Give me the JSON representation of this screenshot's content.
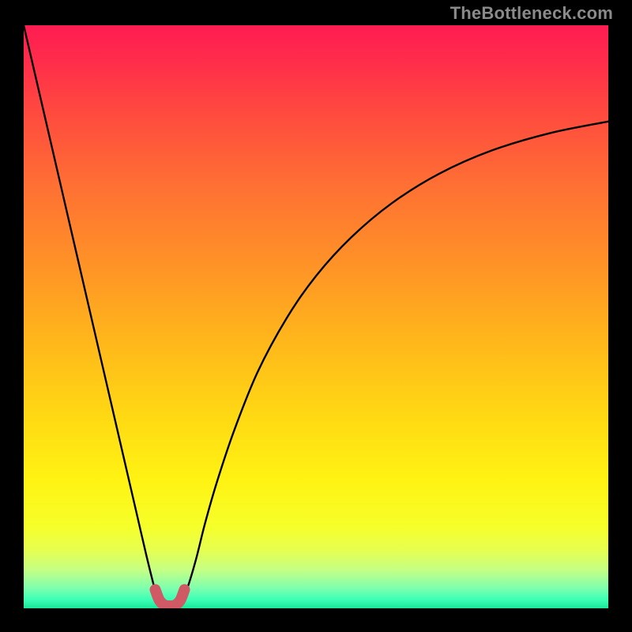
{
  "watermark": "TheBottleneck.com",
  "chart_data": {
    "type": "line",
    "title": "",
    "xlabel": "",
    "ylabel": "",
    "xlim": [
      0,
      1
    ],
    "ylim": [
      0,
      1
    ],
    "series": [
      {
        "name": "bottleneck-curve",
        "x": [
          0.0,
          0.015,
          0.03,
          0.045,
          0.06,
          0.075,
          0.09,
          0.105,
          0.12,
          0.135,
          0.15,
          0.165,
          0.18,
          0.195,
          0.21,
          0.225,
          0.232,
          0.24,
          0.25,
          0.26,
          0.268,
          0.28,
          0.295,
          0.31,
          0.33,
          0.36,
          0.4,
          0.45,
          0.5,
          0.56,
          0.63,
          0.71,
          0.8,
          0.9,
          1.0
        ],
        "y": [
          1.0,
          0.935,
          0.87,
          0.805,
          0.74,
          0.675,
          0.61,
          0.545,
          0.48,
          0.415,
          0.35,
          0.285,
          0.22,
          0.155,
          0.09,
          0.03,
          0.01,
          0.005,
          0.004,
          0.005,
          0.01,
          0.035,
          0.085,
          0.145,
          0.215,
          0.305,
          0.405,
          0.498,
          0.57,
          0.636,
          0.695,
          0.745,
          0.785,
          0.815,
          0.835
        ]
      }
    ],
    "curve_highlight": {
      "name": "valley-marker",
      "color": "#cf5a66",
      "x": [
        0.225,
        0.232,
        0.24,
        0.25,
        0.26,
        0.268,
        0.275
      ],
      "y": [
        0.032,
        0.014,
        0.006,
        0.004,
        0.006,
        0.014,
        0.032
      ]
    },
    "background_gradient": {
      "stops": [
        {
          "offset": 0.0,
          "color": "#ff1c52"
        },
        {
          "offset": 0.06,
          "color": "#ff2c4b"
        },
        {
          "offset": 0.15,
          "color": "#ff4a3f"
        },
        {
          "offset": 0.28,
          "color": "#ff7133"
        },
        {
          "offset": 0.42,
          "color": "#ff9526"
        },
        {
          "offset": 0.55,
          "color": "#ffb91a"
        },
        {
          "offset": 0.68,
          "color": "#ffdb13"
        },
        {
          "offset": 0.78,
          "color": "#fff313"
        },
        {
          "offset": 0.86,
          "color": "#f6ff2a"
        },
        {
          "offset": 0.9,
          "color": "#e6ff50"
        },
        {
          "offset": 0.935,
          "color": "#c4ff86"
        },
        {
          "offset": 0.965,
          "color": "#7fffae"
        },
        {
          "offset": 0.985,
          "color": "#3cffb5"
        },
        {
          "offset": 1.0,
          "color": "#18e89a"
        }
      ]
    }
  }
}
